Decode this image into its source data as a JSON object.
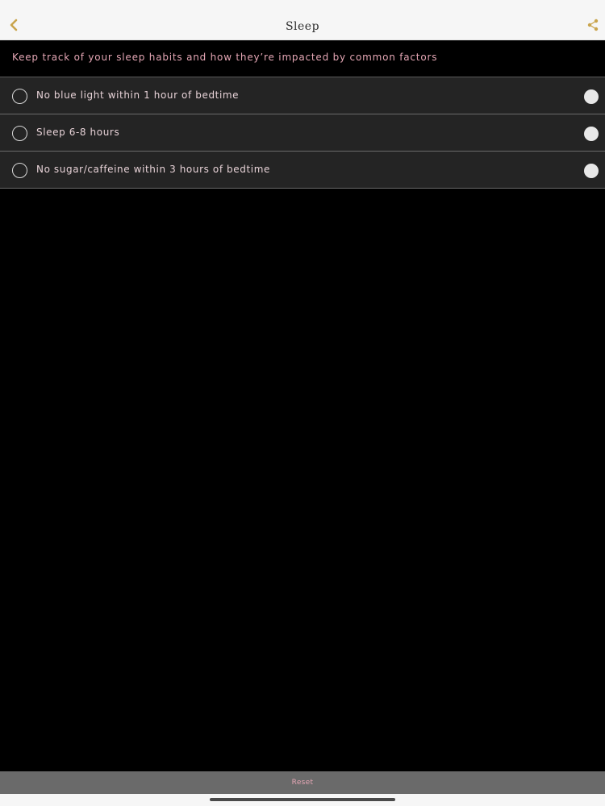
{
  "status_bar": {},
  "nav": {
    "title": "Sleep",
    "back_icon": "chevron-left-icon",
    "share_icon": "share-icon",
    "accent_color": "#c9a44c"
  },
  "subtitle": "Keep track of your sleep habits and how they’re impacted by common factors",
  "items": [
    {
      "label": "No blue light within 1 hour of bedtime"
    },
    {
      "label": "Sleep 6-8 hours"
    },
    {
      "label": "No sugar/caffeine within 3 hours of bedtime"
    }
  ],
  "footer": {
    "reset_label": "Reset"
  },
  "colors": {
    "background": "#000000",
    "row_background": "#242424",
    "accent_text": "#e4a6b4",
    "bar": "#f6f6f6"
  }
}
